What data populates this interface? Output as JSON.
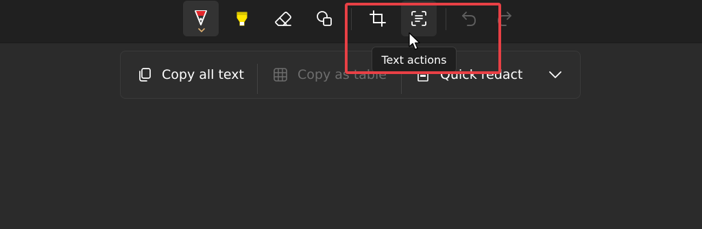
{
  "toolbar": {
    "tools": [
      {
        "name": "pen",
        "icon": "pen-icon",
        "state": "active",
        "color": "#e3262a"
      },
      {
        "name": "highlighter",
        "icon": "highlighter-icon",
        "color": "#ffe500"
      },
      {
        "name": "eraser",
        "icon": "eraser-icon"
      },
      {
        "name": "shapes",
        "icon": "shapes-icon"
      },
      {
        "name": "crop",
        "icon": "crop-icon"
      },
      {
        "name": "text-actions",
        "icon": "text-actions-icon",
        "state": "hover"
      },
      {
        "name": "undo",
        "icon": "undo-icon",
        "state": "disabled"
      },
      {
        "name": "redo",
        "icon": "redo-icon",
        "state": "disabled"
      }
    ]
  },
  "tooltip": {
    "text": "Text actions"
  },
  "text_actions_bar": {
    "copy_all_text": "Copy all text",
    "copy_as_table": "Copy as table",
    "quick_redact": "Quick redact",
    "expand_icon": "chevron-down-icon"
  },
  "colors": {
    "accent_highlight": "#e84045",
    "background": "#2b2b2b",
    "toolbar": "#202020"
  }
}
